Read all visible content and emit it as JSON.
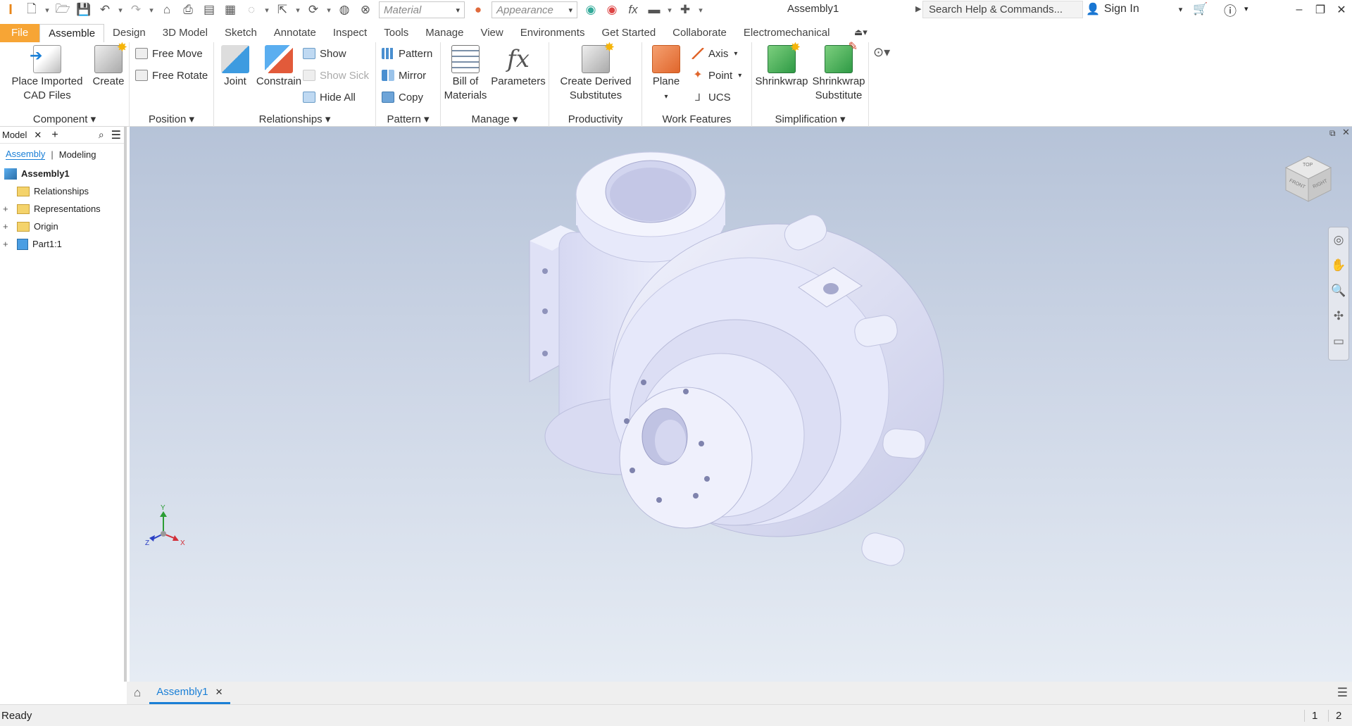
{
  "app": {
    "document_title": "Assembly1"
  },
  "qat": {
    "material_placeholder": "Material",
    "appearance_placeholder": "Appearance",
    "search_placeholder": "Search Help & Commands...",
    "signin_label": "Sign In"
  },
  "tabs": [
    "File",
    "Assemble",
    "Design",
    "3D Model",
    "Sketch",
    "Annotate",
    "Inspect",
    "Tools",
    "Manage",
    "View",
    "Environments",
    "Get Started",
    "Collaborate",
    "Electromechanical"
  ],
  "active_tab": "Assemble",
  "ribbon": {
    "component": {
      "label": "Component",
      "place_imported": "Place Imported\nCAD Files",
      "create": "Create"
    },
    "position": {
      "label": "Position",
      "free_move": "Free Move",
      "free_rotate": "Free Rotate"
    },
    "relationships": {
      "label": "Relationships",
      "joint": "Joint",
      "constrain": "Constrain",
      "show": "Show",
      "show_sick": "Show Sick",
      "hide_all": "Hide All"
    },
    "pattern": {
      "label": "Pattern",
      "pattern": "Pattern",
      "mirror": "Mirror",
      "copy": "Copy"
    },
    "manage": {
      "label": "Manage",
      "bom": "Bill of\nMaterials",
      "parameters": "Parameters"
    },
    "productivity": {
      "label": "Productivity",
      "create_derived": "Create Derived\nSubstitutes"
    },
    "work_features": {
      "label": "Work Features",
      "plane": "Plane",
      "axis": "Axis",
      "point": "Point",
      "ucs": "UCS"
    },
    "simplification": {
      "label": "Simplification",
      "shrinkwrap": "Shrinkwrap",
      "shrinkwrap_sub": "Shrinkwrap\nSubstitute"
    }
  },
  "browser": {
    "title": "Model",
    "add": "+",
    "mode_assembly": "Assembly",
    "mode_modeling": "Modeling",
    "root": "Assembly1",
    "items": [
      "Relationships",
      "Representations",
      "Origin",
      "Part1:1"
    ]
  },
  "viewcube": {
    "top": "TOP",
    "front": "FRONT",
    "right": "RIGHT"
  },
  "triad": {
    "x": "X",
    "y": "Y",
    "z": "Z"
  },
  "doc_tab": "Assembly1",
  "status": {
    "text": "Ready",
    "n1": "1",
    "n2": "2"
  },
  "colors": {
    "file_tab": "#f7a535",
    "active_link": "#1a7fd6",
    "part": "#e2e4f6"
  }
}
